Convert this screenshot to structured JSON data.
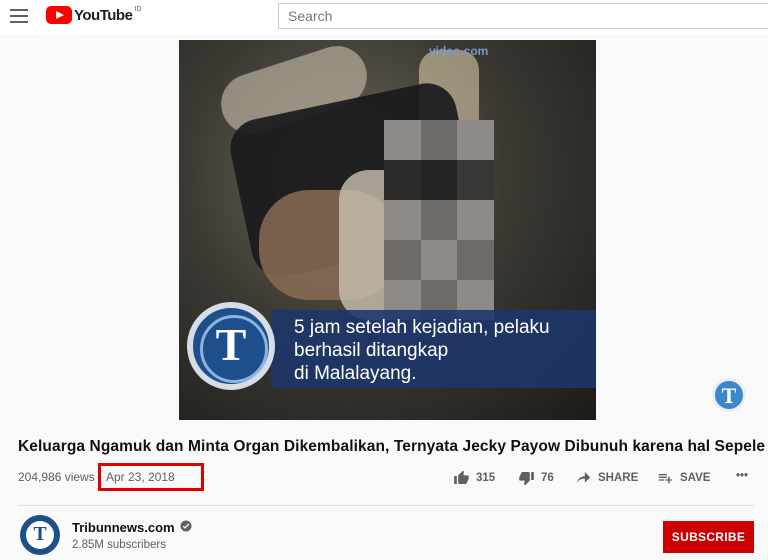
{
  "header": {
    "logo_text": "YouTube",
    "region": "ID",
    "search_placeholder": "Search"
  },
  "video": {
    "caption_lines": [
      "5 jam setelah kejadian, pelaku",
      "berhasil ditangkap",
      "di Malalayang."
    ],
    "emblem_letter": "T",
    "watermark_text": "video.com"
  },
  "info": {
    "title": "Keluarga Ngamuk dan Minta Organ Dikembalikan, Ternyata Jecky Payow Dibunuh karena hal Sepele",
    "views": "204,986 views",
    "date": "Apr 23, 2018",
    "highlight_color": "#e00000"
  },
  "actions": {
    "like_count": "315",
    "dislike_count": "76",
    "share_label": "SHARE",
    "save_label": "SAVE",
    "more_label": "•••"
  },
  "channel": {
    "name": "Tribunnews.com",
    "subscribers": "2.85M subscribers",
    "avatar_letter": "T",
    "subscribe_label": "SUBSCRIBE",
    "subscribe_color": "#cc0000"
  },
  "icons": {
    "menu": "menu-icon",
    "like": "thumbs-up-icon",
    "dislike": "thumbs-down-icon",
    "share": "share-arrow-icon",
    "save": "playlist-add-icon",
    "verified": "verified-check-icon"
  }
}
